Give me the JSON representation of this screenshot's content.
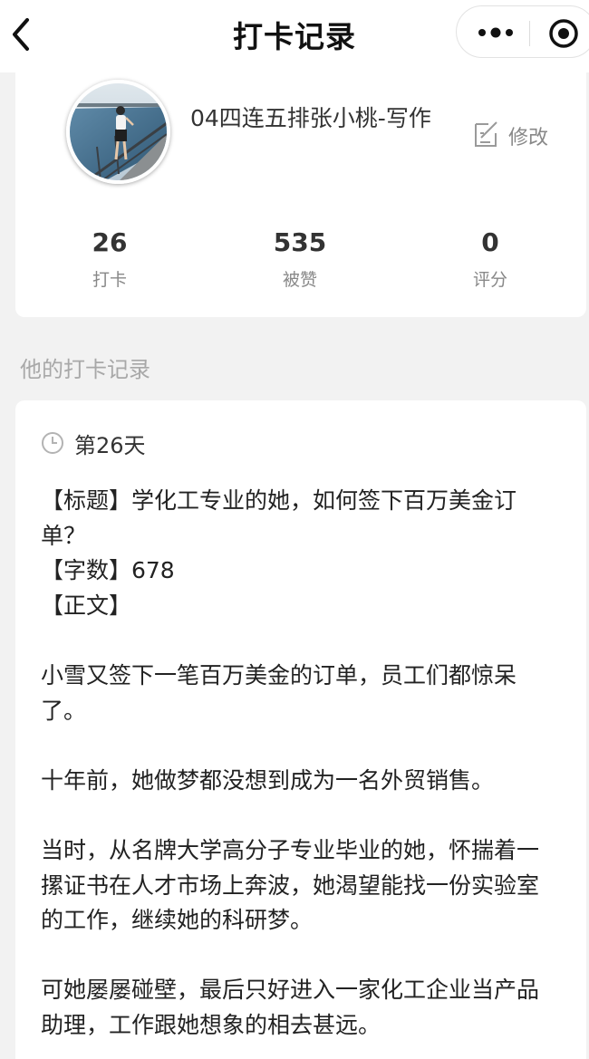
{
  "navbar": {
    "title": "打卡记录",
    "back_icon": "chevron-left-icon",
    "more_icon": "more-dots-icon",
    "close_icon": "target-close-icon"
  },
  "profile": {
    "username": "04四连五排张小桃-写作",
    "edit_label": "修改",
    "edit_icon": "edit-icon",
    "stats": [
      {
        "value": "26",
        "label": "打卡"
      },
      {
        "value": "535",
        "label": "被赞"
      },
      {
        "value": "0",
        "label": "评分"
      }
    ]
  },
  "section_title": "他的打卡记录",
  "record": {
    "day": "第26天",
    "clock_icon": "clock-icon",
    "lines": [
      "【标题】学化工专业的她，如何签下百万美金订单？",
      "【字数】678",
      "【正文】",
      "",
      "小雪又签下一笔百万美金的订单，员工们都惊呆了。",
      "",
      "十年前，她做梦都没想到成为一名外贸销售。",
      "",
      "当时，从名牌大学高分子专业毕业的她，怀揣着一摞证书在人才市场上奔波，她渴望能找一份实验室的工作，继续她的科研梦。",
      "",
      "可她屡屡碰壁，最后只好进入一家化工企业当产品助理，工作跟她想象的相去甚远。"
    ]
  }
}
